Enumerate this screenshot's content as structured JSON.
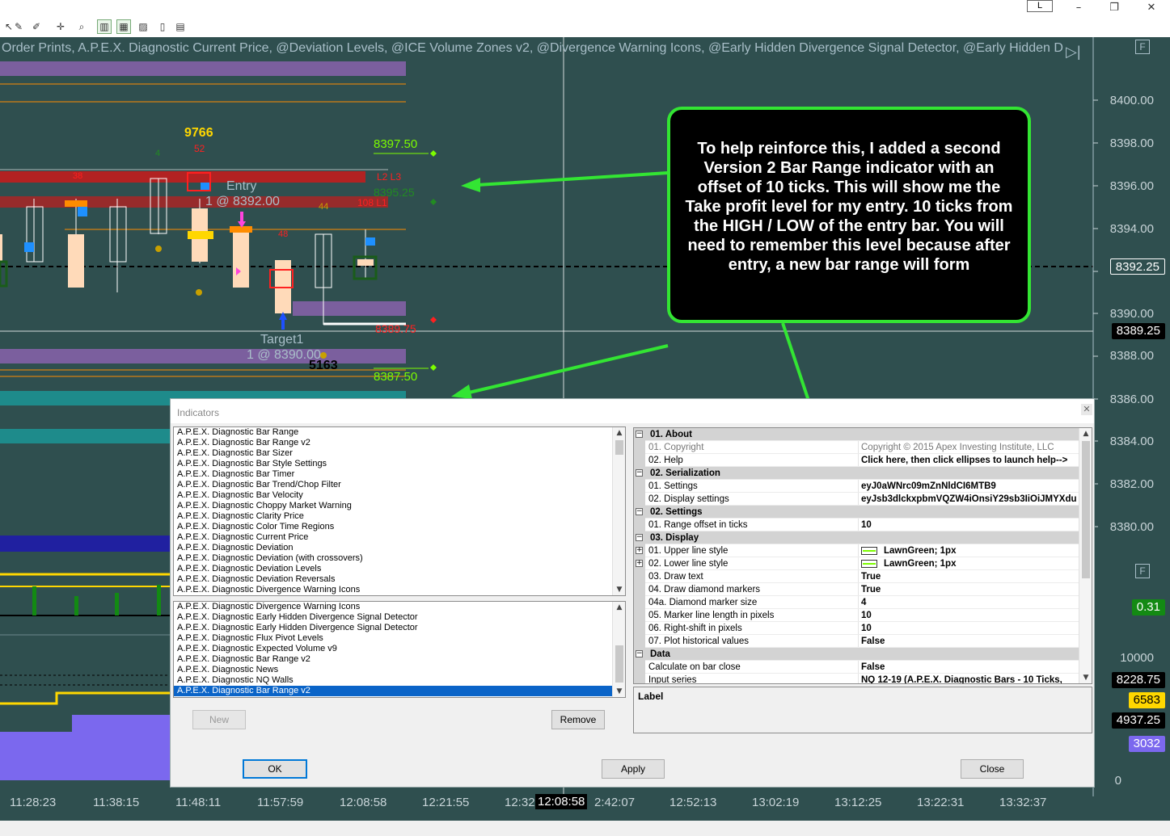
{
  "toolbar": {
    "layout_button": "L",
    "icons": [
      "arrow-tool-icon",
      "pen-tool-icon",
      "crosshair-icon",
      "zoom-icon",
      "bar-type-icon",
      "indicators-icon",
      "strategies-icon",
      "data-box-icon",
      "properties-icon"
    ]
  },
  "chart": {
    "indicator_title": "Order Prints, A.P.E.X. Diagnostic Current Price, @Deviation Levels, @ICE Volume Zones v2, @Divergence Warning Icons, @Early Hidden Divergence Signal Detector, @Early Hidden D",
    "panel_button": "F",
    "price_axis": [
      "8400.00",
      "8398.00",
      "8396.00",
      "8394.00",
      "8392.00",
      "8390.00",
      "8388.00",
      "8386.00",
      "8384.00",
      "8382.00",
      "8380.00"
    ],
    "price_tags": {
      "current": "8392.25",
      "crosshair": "8389.25",
      "osc": "0.31",
      "vol_max": "10000",
      "vol_a": "8228.75",
      "vol_b": "6583",
      "vol_c": "4937.25",
      "vol_d": "3032",
      "vol_zero": "0"
    },
    "time_axis": [
      "11:28:23",
      "11:38:15",
      "11:48:11",
      "11:57:59",
      "12:08:58",
      "12:21:55",
      "12:32",
      "12:08:58",
      "2:42:07",
      "12:52:13",
      "13:02:19",
      "13:12:25",
      "13:22:31",
      "13:32:37"
    ],
    "labels": {
      "volume_top": "9766",
      "volume_top_sub": "52",
      "entry": "Entry",
      "entry_fill": "1 @ 8392.00",
      "target": "Target1",
      "target_fill": "1 @ 8390.00",
      "volume_bottom": "5163",
      "upper_level": "8397.50",
      "lower_level": "8387.50",
      "level_a": "8395.25",
      "level_b": "8389.75",
      "l2": "L2 L3",
      "l1": "108 L1",
      "n38": "38",
      "n48": "48",
      "n44": "44",
      "n4": "4"
    },
    "callout_text": "To help reinforce this, I added a second Version 2 Bar Range indicator with an offset of 10 ticks.  This will show me the Take profit level for my entry. 10 ticks from the HIGH / LOW of the entry bar. You will need to remember this level because after entry, a new bar range will form"
  },
  "dialog": {
    "title": "Indicators",
    "available_indicators": [
      "A.P.E.X. Diagnostic Bar Range",
      "A.P.E.X. Diagnostic Bar Range v2",
      "A.P.E.X. Diagnostic Bar Sizer",
      "A.P.E.X. Diagnostic Bar Style Settings",
      "A.P.E.X. Diagnostic Bar Timer",
      "A.P.E.X. Diagnostic Bar Trend/Chop Filter",
      "A.P.E.X. Diagnostic Bar Velocity",
      "A.P.E.X. Diagnostic Choppy Market Warning",
      "A.P.E.X. Diagnostic Clarity Price",
      "A.P.E.X. Diagnostic Color Time Regions",
      "A.P.E.X. Diagnostic Current Price",
      "A.P.E.X. Diagnostic Deviation",
      "A.P.E.X. Diagnostic Deviation (with crossovers)",
      "A.P.E.X. Diagnostic Deviation Levels",
      "A.P.E.X. Diagnostic Deviation Reversals",
      "A.P.E.X. Diagnostic Divergence Warning Icons"
    ],
    "applied_indicators": [
      "A.P.E.X. Diagnostic Divergence Warning Icons",
      "A.P.E.X. Diagnostic Early Hidden Divergence Signal Detector",
      "A.P.E.X. Diagnostic Early Hidden Divergence Signal Detector",
      "A.P.E.X. Diagnostic Flux Pivot Levels",
      "A.P.E.X. Diagnostic Expected Volume v9",
      "A.P.E.X. Diagnostic Bar Range v2",
      "A.P.E.X. Diagnostic News",
      "A.P.E.X. Diagnostic NQ Walls",
      "A.P.E.X. Diagnostic Bar Range v2"
    ],
    "selected_index": 8,
    "buttons": {
      "new": "New",
      "remove": "Remove",
      "ok": "OK",
      "apply": "Apply",
      "close": "Close"
    },
    "properties": [
      {
        "type": "cat",
        "name": "01. About"
      },
      {
        "type": "prop",
        "name": "01. Copyright",
        "value": "Copyright © 2015 Apex Investing Institute, LLC",
        "dim": true
      },
      {
        "type": "prop",
        "name": "02. Help",
        "value": "Click here, then click ellipses to launch help-->"
      },
      {
        "type": "cat",
        "name": "02. Serialization"
      },
      {
        "type": "prop",
        "name": "01. Settings",
        "value": "eyJ0aWNrc09mZnNldCI6MTB9"
      },
      {
        "type": "prop",
        "name": "02. Display settings",
        "value": "eyJsb3dlckxpbmVQZW4iOnsiY29sb3IiOiJMYXdu"
      },
      {
        "type": "cat",
        "name": "02. Settings"
      },
      {
        "type": "prop",
        "name": "01. Range offset in ticks",
        "value": "10"
      },
      {
        "type": "cat",
        "name": "03. Display"
      },
      {
        "type": "prop",
        "name": "01. Upper line style",
        "value": "LawnGreen; 1px",
        "swatch": true,
        "expand": true
      },
      {
        "type": "prop",
        "name": "02. Lower line style",
        "value": "LawnGreen; 1px",
        "swatch": true,
        "expand": true
      },
      {
        "type": "prop",
        "name": "03. Draw text",
        "value": "True"
      },
      {
        "type": "prop",
        "name": "04. Draw diamond markers",
        "value": "True"
      },
      {
        "type": "prop",
        "name": "04a. Diamond marker size",
        "value": "4"
      },
      {
        "type": "prop",
        "name": "05. Marker line length in pixels",
        "value": "10"
      },
      {
        "type": "prop",
        "name": "06. Right-shift in pixels",
        "value": "10"
      },
      {
        "type": "prop",
        "name": "07. Plot historical values",
        "value": "False"
      },
      {
        "type": "cat",
        "name": "Data"
      },
      {
        "type": "prop",
        "name": "Calculate on bar close",
        "value": "False"
      },
      {
        "type": "prop",
        "name": "Input series",
        "value": "NQ 12-19 (A.P.E.X. Diagnostic Bars - 10 Ticks,"
      }
    ],
    "label_pane": "Label"
  },
  "colors": {
    "chart_bg": "#2f4f4f",
    "level_line": "#7cfc00",
    "callout_border": "#33e533",
    "selection": "#0a64c8"
  }
}
